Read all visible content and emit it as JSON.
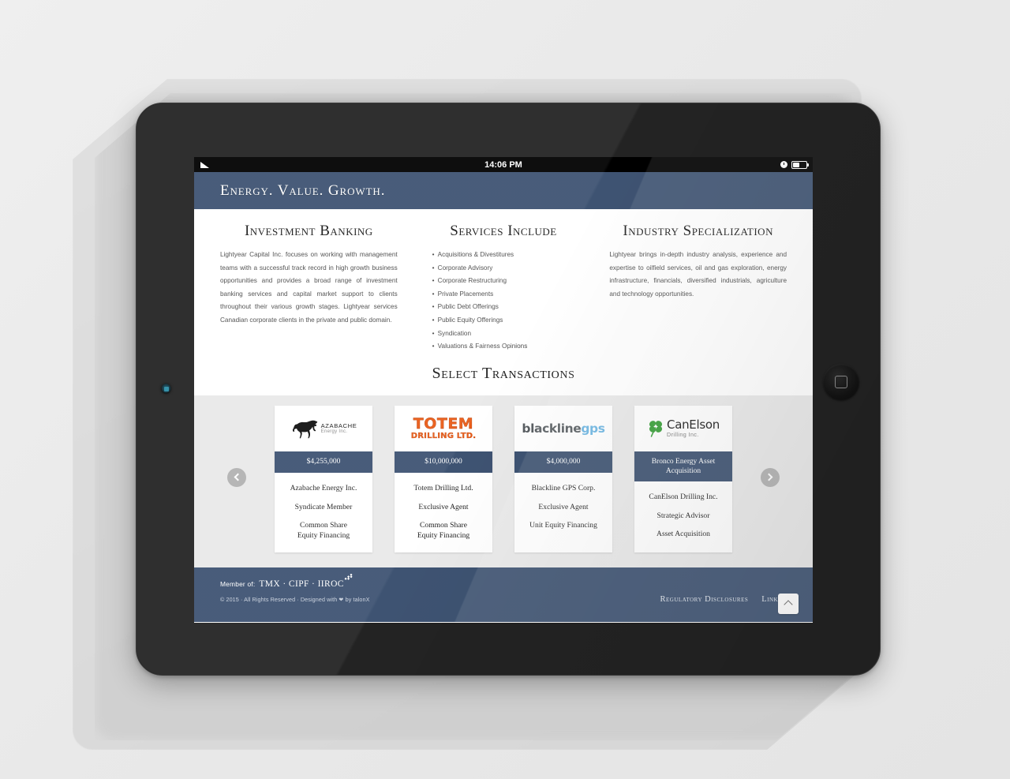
{
  "device": {
    "status_bar": {
      "time": "14:06 PM",
      "signal_icon": "signal-triangle-icon",
      "clock_icon": "alarm-clock-icon",
      "battery_icon": "battery-icon"
    },
    "home_button_icon": "home-square-icon",
    "camera_icon": "front-camera-icon"
  },
  "header": {
    "tagline": "Energy. Value. Growth."
  },
  "columns": [
    {
      "heading": "Investment Banking",
      "type": "paragraph",
      "body": "Lightyear Capital Inc. focuses on working with management teams with a successful track record in high growth business opportunities and provides a broad range of investment banking services and capital market support to clients throughout their various growth stages. Lightyear services Canadian corporate clients in the private and public domain."
    },
    {
      "heading": "Services Include",
      "type": "list",
      "items": [
        "Acquisitions & Divestitures",
        "Corporate Advisory",
        "Corporate Restructuring",
        "Private Placements",
        "Public Debt Offerings",
        "Public Equity Offerings",
        "Syndication",
        "Valuations & Fairness Opinions"
      ]
    },
    {
      "heading": "Industry Specialization",
      "type": "paragraph",
      "body": "Lightyear brings in-depth industry analysis, experience and expertise to oilfield services, oil and gas exploration, energy infrastructure, financials, diversified industrials, agriculture and technology opportunities."
    }
  ],
  "transactions": {
    "heading": "Select Transactions",
    "prev_label": "Previous transactions",
    "next_label": "Next transactions",
    "cards": [
      {
        "logo_name": "azabache-energy-logo",
        "logo_text_primary": "AZABACHE",
        "logo_text_secondary": "Energy Inc.",
        "amount": "$4,255,000",
        "company": "Azabache Energy Inc.",
        "role": "Syndicate Member",
        "deal_line1": "Common Share",
        "deal_line2": "Equity Financing"
      },
      {
        "logo_name": "totem-drilling-logo",
        "logo_text_primary": "TOTEM",
        "logo_text_secondary": "DRILLING LTD.",
        "amount": "$10,000,000",
        "company": "Totem Drilling Ltd.",
        "role": "Exclusive Agent",
        "deal_line1": "Common Share",
        "deal_line2": "Equity Financing"
      },
      {
        "logo_name": "blackline-gps-logo",
        "logo_text_primary": "blackline",
        "logo_text_secondary": "gps",
        "amount": "$4,000,000",
        "company": "Blackline GPS Corp.",
        "role": "Exclusive Agent",
        "deal_line1": "Unit Equity Financing",
        "deal_line2": ""
      },
      {
        "logo_name": "canelson-drilling-logo",
        "logo_text_primary": "CanElson",
        "logo_text_secondary": "Drilling Inc.",
        "amount": "Bronco Energy Asset Acquisition",
        "company": "CanElson Drilling Inc.",
        "role": "Strategic Advisor",
        "deal_line1": "Asset Acquisition",
        "deal_line2": ""
      }
    ]
  },
  "footer": {
    "member_prefix": "Member of:",
    "member_logos": "TMX · CIPF · IIROC",
    "copyright": "© 2015 · All Rights Reserved · Designed with ❤ by talonX",
    "links": [
      {
        "label": "Regulatory Disclosures",
        "name": "regulatory-disclosures-link"
      },
      {
        "label": "LinkedIn",
        "name": "linkedin-link"
      }
    ],
    "to_top_label": "Back to top"
  },
  "colors": {
    "navy": "#3e5372",
    "carousel_bg": "#e9e9e9",
    "totem_orange": "#ea5b16",
    "blackline_blue": "#6fb7e3",
    "clover_green": "#3aa03a"
  }
}
